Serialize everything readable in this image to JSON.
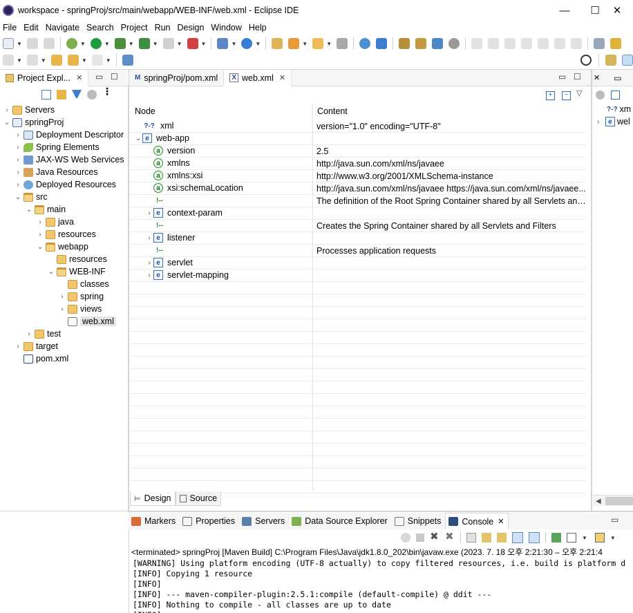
{
  "window": {
    "title": "workspace - springProj/src/main/webapp/WEB-INF/web.xml - Eclipse IDE",
    "minimize": "—",
    "maximize": "☐",
    "close": "✕"
  },
  "menu": [
    "File",
    "Edit",
    "Navigate",
    "Search",
    "Project",
    "Run",
    "Design",
    "Window",
    "Help"
  ],
  "project_explorer": {
    "tab_label": "Project Expl...",
    "tree": [
      {
        "label": "Servers",
        "indent": 0,
        "chev": "›",
        "icon": "folder"
      },
      {
        "label": "springProj",
        "indent": 0,
        "chev": "⌄",
        "icon": "maven-project"
      },
      {
        "label": "Deployment Descriptor",
        "indent": 1,
        "chev": "›",
        "icon": "descriptor"
      },
      {
        "label": "Spring Elements",
        "indent": 1,
        "chev": "›",
        "icon": "spring"
      },
      {
        "label": "JAX-WS Web Services",
        "indent": 1,
        "chev": "›",
        "icon": "webservice"
      },
      {
        "label": "Java Resources",
        "indent": 1,
        "chev": "›",
        "icon": "java-res"
      },
      {
        "label": "Deployed Resources",
        "indent": 1,
        "chev": "›",
        "icon": "deployed"
      },
      {
        "label": "src",
        "indent": 1,
        "chev": "⌄",
        "icon": "folder-open"
      },
      {
        "label": "main",
        "indent": 2,
        "chev": "⌄",
        "icon": "folder-open"
      },
      {
        "label": "java",
        "indent": 3,
        "chev": "›",
        "icon": "folder"
      },
      {
        "label": "resources",
        "indent": 3,
        "chev": "›",
        "icon": "folder"
      },
      {
        "label": "webapp",
        "indent": 3,
        "chev": "⌄",
        "icon": "folder-open"
      },
      {
        "label": "resources",
        "indent": 4,
        "chev": "",
        "icon": "folder"
      },
      {
        "label": "WEB-INF",
        "indent": 4,
        "chev": "⌄",
        "icon": "folder-open"
      },
      {
        "label": "classes",
        "indent": 5,
        "chev": "",
        "icon": "folder"
      },
      {
        "label": "spring",
        "indent": 5,
        "chev": "›",
        "icon": "folder"
      },
      {
        "label": "views",
        "indent": 5,
        "chev": "›",
        "icon": "folder"
      },
      {
        "label": "web.xml",
        "indent": 5,
        "chev": "",
        "icon": "xml-file",
        "selected": true
      },
      {
        "label": "test",
        "indent": 2,
        "chev": "›",
        "icon": "folder"
      },
      {
        "label": "target",
        "indent": 1,
        "chev": "›",
        "icon": "folder"
      },
      {
        "label": "pom.xml",
        "indent": 1,
        "chev": "",
        "icon": "maven-file"
      }
    ]
  },
  "editor": {
    "tabs": [
      {
        "label": "springProj/pom.xml",
        "active": false
      },
      {
        "label": "web.xml",
        "active": true
      }
    ],
    "columns": {
      "node": "Node",
      "content": "Content"
    },
    "rows": [
      {
        "node": "xml",
        "content": "version=\"1.0\" encoding=\"UTF-8\"",
        "kind": "pi",
        "depth": 0,
        "chev": ""
      },
      {
        "node": "web-app",
        "content": "",
        "kind": "element",
        "depth": 0,
        "chev": "⌄"
      },
      {
        "node": "version",
        "content": "2.5",
        "kind": "attribute",
        "depth": 1,
        "chev": ""
      },
      {
        "node": "xmlns",
        "content": "http://java.sun.com/xml/ns/javaee",
        "kind": "attribute",
        "depth": 1,
        "chev": ""
      },
      {
        "node": "xmlns:xsi",
        "content": "http://www.w3.org/2001/XMLSchema-instance",
        "kind": "attribute",
        "depth": 1,
        "chev": ""
      },
      {
        "node": "xsi:schemaLocation",
        "content": "http://java.sun.com/xml/ns/javaee https://java.sun.com/xml/ns/javaee...",
        "kind": "attribute",
        "depth": 1,
        "chev": ""
      },
      {
        "node": "",
        "content": " The definition of the Root Spring Container shared by all Servlets and...",
        "kind": "comment",
        "depth": 1,
        "chev": ""
      },
      {
        "node": "context-param",
        "content": "",
        "kind": "element",
        "depth": 1,
        "chev": "›"
      },
      {
        "node": "",
        "content": " Creates the Spring Container shared by all Servlets and Filters",
        "kind": "comment",
        "depth": 1,
        "chev": ""
      },
      {
        "node": "listener",
        "content": "",
        "kind": "element",
        "depth": 1,
        "chev": "›"
      },
      {
        "node": "",
        "content": " Processes application requests",
        "kind": "comment",
        "depth": 1,
        "chev": ""
      },
      {
        "node": "servlet",
        "content": "",
        "kind": "element",
        "depth": 1,
        "chev": "›"
      },
      {
        "node": "servlet-mapping",
        "content": "",
        "kind": "element",
        "depth": 1,
        "chev": "›"
      }
    ],
    "bottom_tabs": {
      "design": "Design",
      "source": "Source"
    }
  },
  "outline": {
    "rows": [
      {
        "label": "xm",
        "icon": "?-?"
      },
      {
        "label": "wel",
        "icon": "e"
      }
    ]
  },
  "console": {
    "tabs": [
      "Markers",
      "Properties",
      "Servers",
      "Data Source Explorer",
      "Snippets",
      "Console"
    ],
    "status": "<terminated> springProj [Maven Build] C:\\Program Files\\Java\\jdk1.8.0_202\\bin\\javaw.exe  (2023. 7. 18 오후 2:21:30 – 오후 2:21:4",
    "lines": [
      "[WARNING] Using platform encoding (UTF-8 actually) to copy filtered resources, i.e. build is platform d",
      "[INFO] Copying 1 resource",
      "[INFO]",
      "[INFO] --- maven-compiler-plugin:2.5.1:compile (default-compile) @ ddit ---",
      "[INFO] Nothing to compile - all classes are up to date",
      "[INFO]"
    ]
  },
  "colors": {
    "border": "#d5d5d5",
    "selection": "#e5e5e5",
    "element_icon": "#1f4f9e",
    "attribute_icon": "#2f8a2f"
  }
}
